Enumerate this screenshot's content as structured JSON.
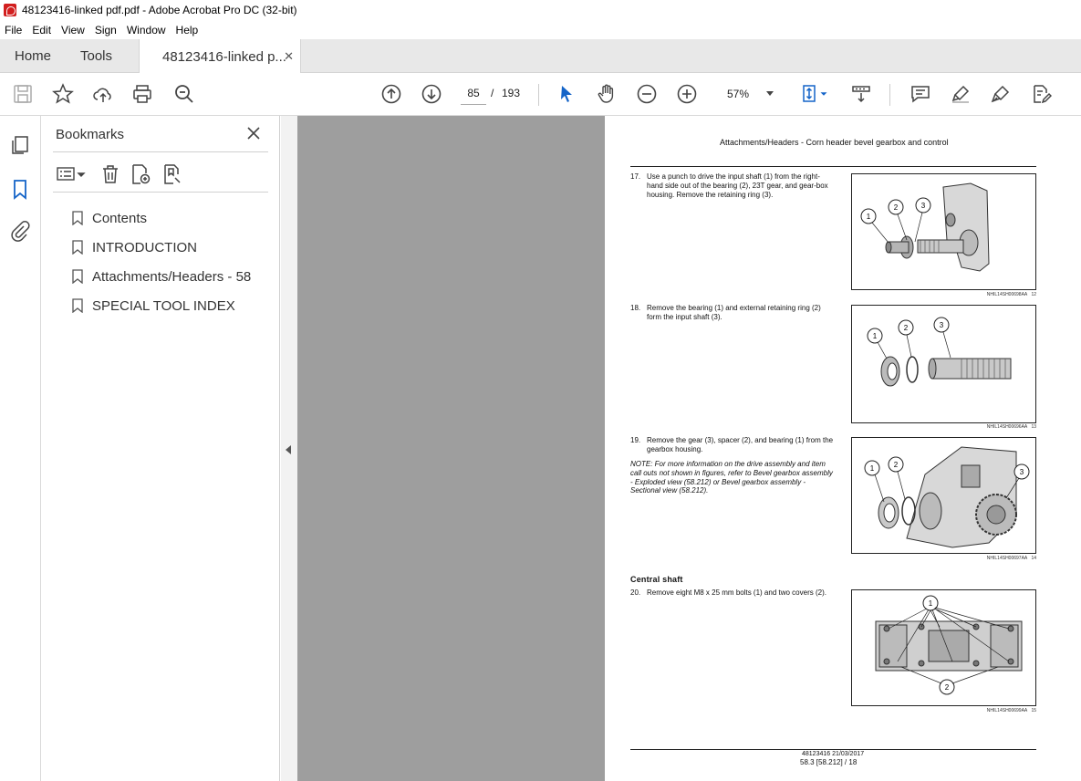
{
  "window": {
    "title": "48123416-linked pdf.pdf - Adobe Acrobat Pro DC (32-bit)"
  },
  "menu": [
    "File",
    "Edit",
    "View",
    "Sign",
    "Window",
    "Help"
  ],
  "tabs": {
    "home": "Home",
    "tools": "Tools",
    "document": "48123416-linked p..."
  },
  "toolbar": {
    "current_page": "85",
    "page_separator": "/",
    "total_pages": "193",
    "zoom": "57%"
  },
  "bookmarks": {
    "title": "Bookmarks",
    "items": [
      "Contents",
      "INTRODUCTION",
      "Attachments/Headers - 58",
      "SPECIAL TOOL INDEX"
    ]
  },
  "page": {
    "header": "Attachments/Headers - Corn header bevel gearbox and control",
    "steps": [
      {
        "num": "17.",
        "text": "Use a punch to drive the input shaft (1) from the right-hand side out of the bearing (2), 23T gear, and gear-box housing. Remove the retaining ring (3)."
      },
      {
        "num": "18.",
        "text": "Remove the bearing (1) and external retaining ring (2) form the input shaft (3)."
      },
      {
        "num": "19.",
        "text": "Remove the gear (3), spacer (2), and bearing (1) from the gearbox housing."
      },
      {
        "num": "20.",
        "text": "Remove eight M8 x 25 mm bolts (1) and two covers (2)."
      }
    ],
    "note": "NOTE: For more information on the drive assembly and item call outs not shown in figures, refer to Bevel gearbox assembly - Exploded view (58.212) or Bevel gearbox assembly - Sectional view (58.212).",
    "section": "Central shaft",
    "figures": [
      {
        "code": "NHIL14SH00698AA",
        "num": "12",
        "callouts": [
          "1",
          "2",
          "3"
        ]
      },
      {
        "code": "NHIL14SH00696AA",
        "num": "13",
        "callouts": [
          "1",
          "2",
          "3"
        ]
      },
      {
        "code": "NHIL14SH00697AA",
        "num": "14",
        "callouts": [
          "1",
          "2",
          "3"
        ]
      },
      {
        "code": "NHIL14SH00699AA",
        "num": "15",
        "callouts": [
          "1",
          "2"
        ]
      }
    ],
    "footer_line1": "48123416 21/03/2017",
    "footer_line2": "58.3 [58.212] / 18"
  }
}
